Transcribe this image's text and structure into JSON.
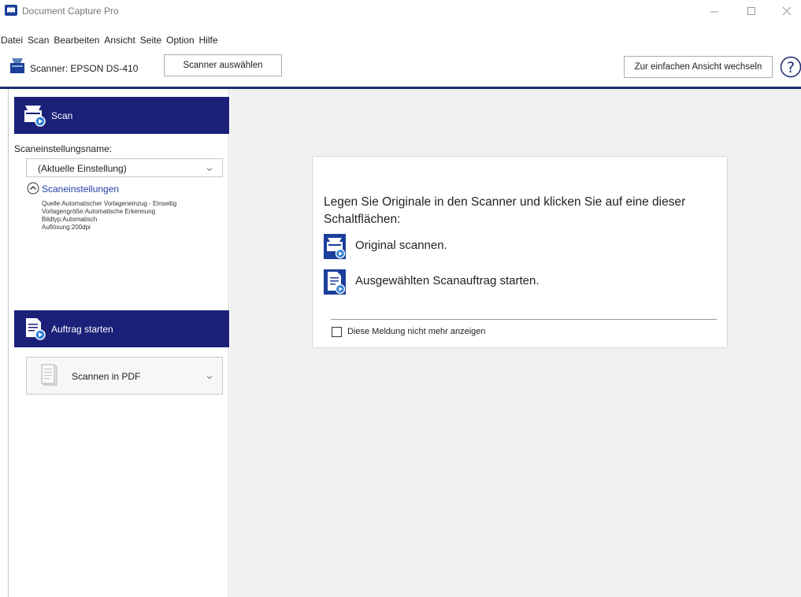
{
  "window": {
    "title": "Document Capture Pro"
  },
  "menu": [
    "Datei",
    "Scan",
    "Bearbeiten",
    "Ansicht",
    "Seite",
    "Option",
    "Hilfe"
  ],
  "toolbar": {
    "scanner_label": "Scanner: EPSON DS-410",
    "select_scanner_button": "Scanner auswählen",
    "simple_view_button": "Zur einfachen Ansicht wechseln"
  },
  "left_panel": {
    "scan_header": "Scan",
    "settings_name_label": "Scaneinstellungsname:",
    "settings_name_value": "(Aktuelle Einstellung)",
    "settings_link": "Scaneinstellungen",
    "settings_details": [
      "Quelle:Automatischer Vorlageneinzug - Einseitig",
      "Vorlagengröße:Automatische Erkennung",
      "Bildtyp:Automatisch",
      "Auflösung:200dpi"
    ],
    "job_header": "Auftrag starten",
    "job_value": "Scannen in PDF"
  },
  "main": {
    "instruction": "Legen Sie Originale in den Scanner und klicken Sie auf eine dieser Schaltflächen:",
    "action_scan": "Original scannen.",
    "action_job": "Ausgewählten Scanauftrag starten.",
    "checkbox_label": "Diese Meldung nicht mehr anzeigen",
    "checkbox_checked": false
  },
  "colors": {
    "accent": "#1b2079",
    "link": "#1e3fa8",
    "main_bg": "#f0f0f0"
  }
}
